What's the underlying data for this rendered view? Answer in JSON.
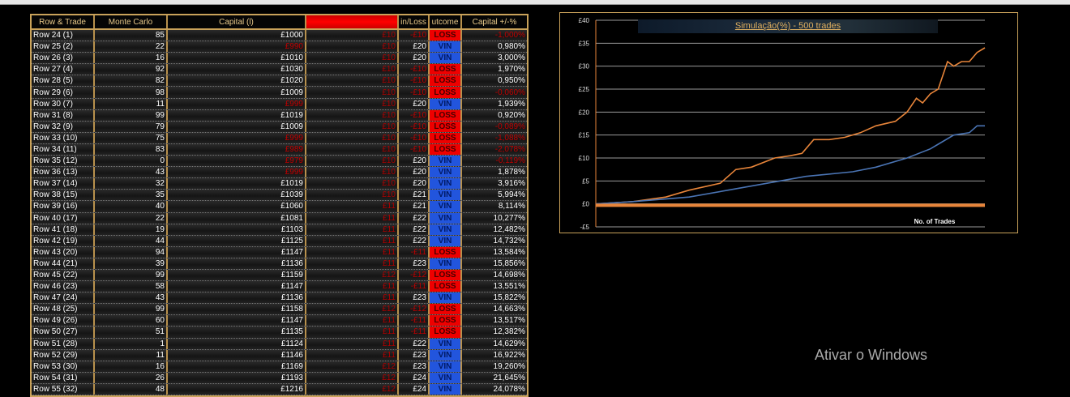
{
  "table": {
    "headers": [
      "Row & Trade",
      "Monte Carlo",
      "Capital (l)",
      "",
      "in/Loss",
      "utcome",
      "Capital +/-%"
    ],
    "rows": [
      [
        "Row 24 (1)",
        "85",
        "£1000",
        "£10",
        "-£10",
        "LOSS",
        "-1,000%"
      ],
      [
        "Row 25 (2)",
        "22",
        "£990",
        "£10",
        "£20",
        "VIN",
        "0,980%"
      ],
      [
        "Row 26 (3)",
        "16",
        "£1010",
        "£10",
        "£20",
        "VIN",
        "3,000%"
      ],
      [
        "Row 27 (4)",
        "92",
        "£1030",
        "£10",
        "-£10",
        "LOSS",
        "1,970%"
      ],
      [
        "Row 28 (5)",
        "82",
        "£1020",
        "£10",
        "-£10",
        "LOSS",
        "0,950%"
      ],
      [
        "Row 29 (6)",
        "98",
        "£1009",
        "£10",
        "-£10",
        "LOSS",
        "-0,060%"
      ],
      [
        "Row 30 (7)",
        "11",
        "£999",
        "£10",
        "£20",
        "VIN",
        "1,939%"
      ],
      [
        "Row 31 (8)",
        "99",
        "£1019",
        "£10",
        "-£10",
        "LOSS",
        "0,920%"
      ],
      [
        "Row 32 (9)",
        "79",
        "£1009",
        "£10",
        "-£10",
        "LOSS",
        "-0,089%"
      ],
      [
        "Row 33 (10)",
        "75",
        "£999",
        "£10",
        "-£10",
        "LOSS",
        "-1,088%"
      ],
      [
        "Row 34 (11)",
        "83",
        "£989",
        "£10",
        "-£10",
        "LOSS",
        "-2,078%"
      ],
      [
        "Row 35 (12)",
        "0",
        "£979",
        "£10",
        "£20",
        "VIN",
        "-0,119%"
      ],
      [
        "Row 36 (13)",
        "43",
        "£999",
        "£10",
        "£20",
        "VIN",
        "1,878%"
      ],
      [
        "Row 37 (14)",
        "32",
        "£1019",
        "£10",
        "£20",
        "VIN",
        "3,916%"
      ],
      [
        "Row 38 (15)",
        "35",
        "£1039",
        "£10",
        "£21",
        "VIN",
        "5,994%"
      ],
      [
        "Row 39 (16)",
        "40",
        "£1060",
        "£11",
        "£21",
        "VIN",
        "8,114%"
      ],
      [
        "Row 40 (17)",
        "22",
        "£1081",
        "£11",
        "£22",
        "VIN",
        "10,277%"
      ],
      [
        "Row 41 (18)",
        "19",
        "£1103",
        "£11",
        "£22",
        "VIN",
        "12,482%"
      ],
      [
        "Row 42 (19)",
        "44",
        "£1125",
        "£11",
        "£22",
        "VIN",
        "14,732%"
      ],
      [
        "Row 43 (20)",
        "94",
        "£1147",
        "£11",
        "-£11",
        "LOSS",
        "13,584%"
      ],
      [
        "Row 44 (21)",
        "39",
        "£1136",
        "£11",
        "£23",
        "VIN",
        "15,856%"
      ],
      [
        "Row 45 (22)",
        "99",
        "£1159",
        "£12",
        "-£12",
        "LOSS",
        "14,698%"
      ],
      [
        "Row 46 (23)",
        "58",
        "£1147",
        "£11",
        "-£11",
        "LOSS",
        "13,551%"
      ],
      [
        "Row 47 (24)",
        "43",
        "£1136",
        "£11",
        "£23",
        "VIN",
        "15,822%"
      ],
      [
        "Row 48 (25)",
        "99",
        "£1158",
        "£12",
        "-£12",
        "LOSS",
        "14,663%"
      ],
      [
        "Row 49 (26)",
        "60",
        "£1147",
        "£11",
        "-£11",
        "LOSS",
        "13,517%"
      ],
      [
        "Row 50 (27)",
        "51",
        "£1135",
        "£11",
        "-£11",
        "LOSS",
        "12,382%"
      ],
      [
        "Row 51 (28)",
        "1",
        "£1124",
        "£11",
        "£22",
        "VIN",
        "14,629%"
      ],
      [
        "Row 52 (29)",
        "11",
        "£1146",
        "£11",
        "£23",
        "VIN",
        "16,922%"
      ],
      [
        "Row 53 (30)",
        "16",
        "£1169",
        "£12",
        "£23",
        "VIN",
        "19,260%"
      ],
      [
        "Row 54 (31)",
        "26",
        "£1193",
        "£12",
        "£24",
        "VIN",
        "21,645%"
      ],
      [
        "Row 55 (32)",
        "48",
        "£1216",
        "£12",
        "£24",
        "VIN",
        "24,078%"
      ]
    ]
  },
  "colors": {
    "win": "#2255dd",
    "loss": "#ee0000",
    "accent": "#c9a25a",
    "orange": "#e8853a",
    "blue": "#4a74b4"
  },
  "chart_data": {
    "type": "line",
    "title": "Simulação(%) - 500 trades",
    "xlabel": "No. of Trades",
    "ylabel": "",
    "xlim": [
      0,
      500
    ],
    "ylim": [
      -5,
      40
    ],
    "yticks": [
      "-£5",
      "£0",
      "£5",
      "£10",
      "£15",
      "£20",
      "£25",
      "£30",
      "£35",
      "£40"
    ],
    "grid": true,
    "series": [
      {
        "color": "#e8853a",
        "x": [
          0,
          48,
          90,
          120,
          160,
          180,
          200,
          230,
          250,
          265,
          280,
          300,
          320,
          340,
          360,
          385,
          400,
          412,
          420,
          430,
          440,
          452,
          460,
          470,
          480,
          490,
          500
        ],
        "y": [
          0,
          0.5,
          1.5,
          3,
          4.5,
          7.5,
          8,
          10,
          10.5,
          11,
          14,
          14,
          14.5,
          15.5,
          17,
          18,
          20,
          23,
          22,
          24,
          25,
          31,
          30,
          31,
          31,
          33,
          34
        ]
      },
      {
        "color": "#4a74b4",
        "x": [
          0,
          48,
          120,
          170,
          220,
          270,
          330,
          360,
          400,
          430,
          440,
          460,
          480,
          490,
          500
        ],
        "y": [
          0,
          0.5,
          1.5,
          3,
          4.5,
          6,
          7,
          8,
          10,
          12,
          13,
          15,
          15.5,
          17,
          17
        ]
      },
      {
        "color": "#e8853a",
        "x": [
          0,
          500
        ],
        "y": [
          -0.3,
          -0.3
        ]
      }
    ]
  },
  "watermark": "Ativar o Windows"
}
